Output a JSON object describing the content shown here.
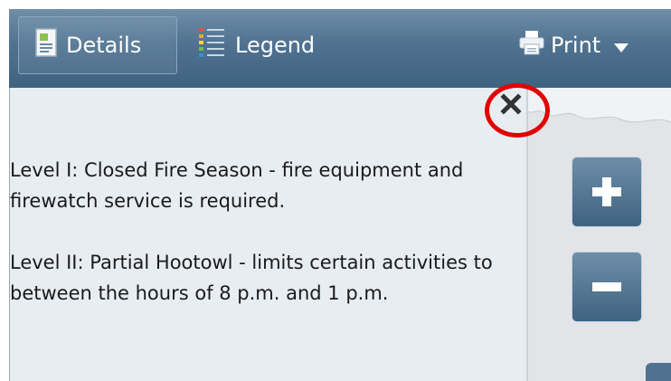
{
  "toolbar": {
    "details_label": "Details",
    "legend_label": "Legend",
    "print_label": "Print",
    "icons": {
      "details": "document-details-icon",
      "legend": "legend-list-icon",
      "print": "printer-icon",
      "print_menu": "chevron-down-icon"
    }
  },
  "panel": {
    "close_icon": "close-icon",
    "paragraphs": [
      "Level I: Closed Fire Season - fire equipment and firewatch service is required.",
      "Level II: Partial Hootowl - limits certain activities to between the hours of 8 p.m. and 1 p.m."
    ]
  },
  "map": {
    "zoom_in_icon": "plus-icon",
    "zoom_out_icon": "minus-icon"
  },
  "colors": {
    "toolbar": "#4f7290",
    "panel_bg": "#e8edf2",
    "annotation": "#e10000"
  }
}
